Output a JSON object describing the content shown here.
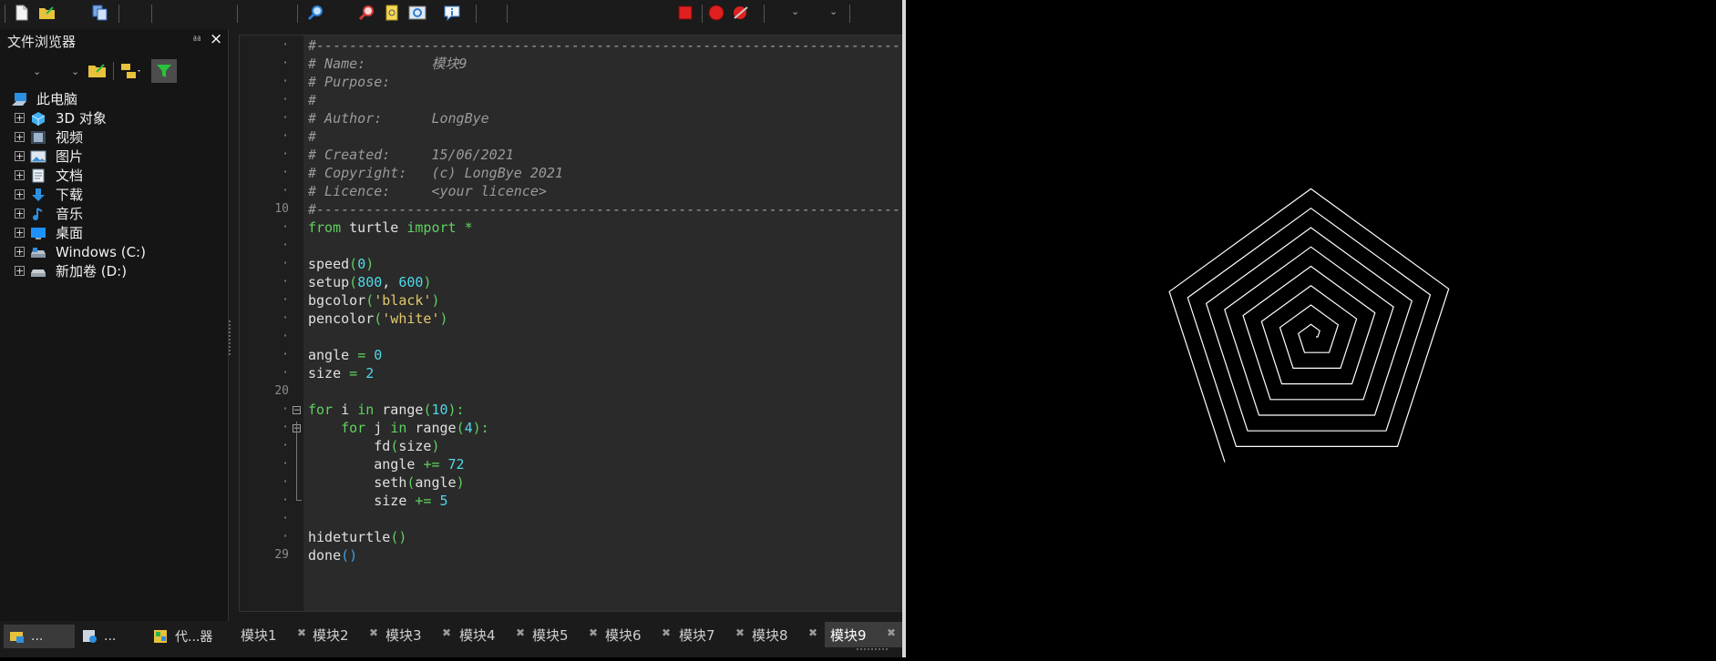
{
  "toolbar": {
    "icons": [
      "new-file-icon",
      "open-file-icon",
      "copy-icon",
      "find-icon",
      "find-next-icon",
      "goto-icon",
      "zoom-icon",
      "info-icon",
      "stop-icon",
      "record-icon",
      "clear-icon"
    ],
    "colors": {
      "stop": "#e02020",
      "record": "#e02020"
    }
  },
  "file_browser": {
    "title": "文件浏览器",
    "pin_glyph": "⎂",
    "close_glyph": "×",
    "tree": [
      {
        "label": "此电脑",
        "icon": "computer-icon"
      },
      {
        "label": "3D 对象",
        "icon": "cube-icon"
      },
      {
        "label": "视频",
        "icon": "video-icon"
      },
      {
        "label": "图片",
        "icon": "picture-icon"
      },
      {
        "label": "文档",
        "icon": "document-icon"
      },
      {
        "label": "下载",
        "icon": "download-icon"
      },
      {
        "label": "音乐",
        "icon": "music-icon"
      },
      {
        "label": "桌面",
        "icon": "desktop-icon"
      },
      {
        "label": "Windows (C:)",
        "icon": "drive-icon"
      },
      {
        "label": "新加卷 (D:)",
        "icon": "drive-icon"
      }
    ],
    "bottom_tabs": [
      "...",
      "...",
      "代...器"
    ]
  },
  "editor": {
    "line_markers": [
      "·",
      "·",
      "·",
      "·",
      "·",
      "·",
      "·",
      "·",
      "·",
      "10",
      "·",
      "·",
      "·",
      "·",
      "·",
      "·",
      "·",
      "·",
      "·",
      "20",
      "·",
      "·",
      "·",
      "·",
      "·",
      "·",
      "·",
      "·",
      "29"
    ],
    "code_lines": [
      [
        [
          "cm",
          "#-----------------------------------------------------------------------"
        ]
      ],
      [
        [
          "cm",
          "# Name:        模块9"
        ]
      ],
      [
        [
          "cm",
          "# Purpose:"
        ]
      ],
      [
        [
          "cm",
          "#"
        ]
      ],
      [
        [
          "cm",
          "# Author:      LongBye"
        ]
      ],
      [
        [
          "cm",
          "#"
        ]
      ],
      [
        [
          "cm",
          "# Created:     15/06/2021"
        ]
      ],
      [
        [
          "cm",
          "# Copyright:   (c) LongBye 2021"
        ]
      ],
      [
        [
          "cm",
          "# Licence:     <your licence>"
        ]
      ],
      [
        [
          "cm",
          "#-----------------------------------------------------------------------"
        ]
      ],
      [
        [
          "kw",
          "from"
        ],
        [
          "tx",
          " turtle "
        ],
        [
          "kw",
          "import"
        ],
        [
          "op",
          " *"
        ]
      ],
      [],
      [
        [
          "tx",
          "speed"
        ],
        [
          "pn",
          "("
        ],
        [
          "nm",
          "0"
        ],
        [
          "pn",
          ")"
        ]
      ],
      [
        [
          "tx",
          "setup"
        ],
        [
          "pn",
          "("
        ],
        [
          "nm",
          "800"
        ],
        [
          "tx",
          ", "
        ],
        [
          "nm",
          "600"
        ],
        [
          "pn",
          ")"
        ]
      ],
      [
        [
          "tx",
          "bgcolor"
        ],
        [
          "pn",
          "("
        ],
        [
          "st",
          "'black'"
        ],
        [
          "pn",
          ")"
        ]
      ],
      [
        [
          "tx",
          "pencolor"
        ],
        [
          "pn",
          "("
        ],
        [
          "st",
          "'white'"
        ],
        [
          "pn",
          ")"
        ]
      ],
      [],
      [
        [
          "tx",
          "angle "
        ],
        [
          "op",
          "="
        ],
        [
          "nm",
          " 0"
        ]
      ],
      [
        [
          "tx",
          "size "
        ],
        [
          "op",
          "="
        ],
        [
          "nm",
          " 2"
        ]
      ],
      [],
      [
        [
          "kw",
          "for"
        ],
        [
          "tx",
          " i "
        ],
        [
          "kw",
          "in"
        ],
        [
          "tx",
          " range"
        ],
        [
          "pn",
          "("
        ],
        [
          "nm",
          "10"
        ],
        [
          "pn",
          "):"
        ]
      ],
      [
        [
          "tx",
          "    "
        ],
        [
          "kw",
          "for"
        ],
        [
          "tx",
          " j "
        ],
        [
          "kw",
          "in"
        ],
        [
          "tx",
          " range"
        ],
        [
          "pn",
          "("
        ],
        [
          "nm",
          "4"
        ],
        [
          "pn",
          "):"
        ]
      ],
      [
        [
          "tx",
          "        fd"
        ],
        [
          "pn",
          "("
        ],
        [
          "tx",
          "size"
        ],
        [
          "pn",
          ")"
        ]
      ],
      [
        [
          "tx",
          "        angle "
        ],
        [
          "op",
          "+="
        ],
        [
          "nm",
          " 72"
        ]
      ],
      [
        [
          "tx",
          "        seth"
        ],
        [
          "pn",
          "("
        ],
        [
          "tx",
          "angle"
        ],
        [
          "pn",
          ")"
        ]
      ],
      [
        [
          "tx",
          "        size "
        ],
        [
          "op",
          "+="
        ],
        [
          "nm",
          " 5"
        ]
      ],
      [],
      [
        [
          "tx",
          "hideturtle"
        ],
        [
          "pn",
          "()"
        ]
      ],
      [
        [
          "tx",
          "done"
        ],
        [
          "pn2",
          "()"
        ]
      ]
    ]
  },
  "module_tabs": [
    "模块1",
    "模块2",
    "模块3",
    "模块4",
    "模块5",
    "模块6",
    "模块7",
    "模块8",
    "模块9"
  ],
  "active_tab": "模块9",
  "turtle_canvas": {
    "background": "#000000",
    "pen": "#ffffff",
    "speed": 0,
    "outer_loops": 10,
    "inner_loops": 4,
    "angle_step": 72,
    "size_start": 2,
    "size_step": 5
  }
}
